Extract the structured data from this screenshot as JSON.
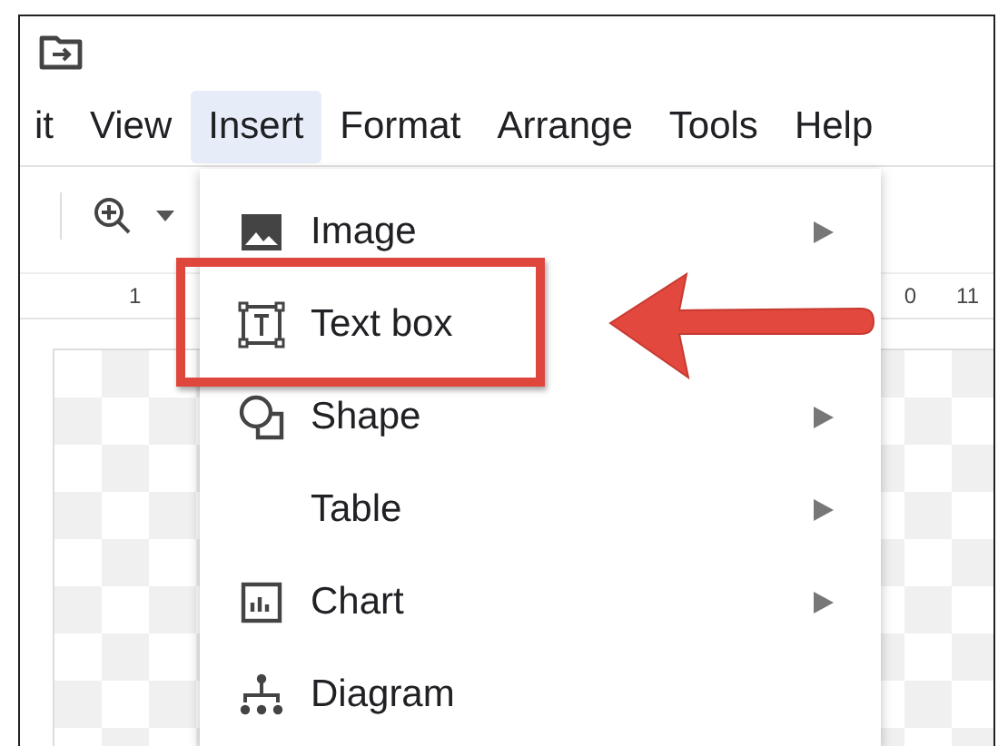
{
  "menu_bar": [
    {
      "label": "it",
      "selected": false
    },
    {
      "label": "View",
      "selected": false
    },
    {
      "label": "Insert",
      "selected": true
    },
    {
      "label": "Format",
      "selected": false
    },
    {
      "label": "Arrange",
      "selected": false
    },
    {
      "label": "Tools",
      "selected": false
    },
    {
      "label": "Help",
      "selected": false
    }
  ],
  "ruler": {
    "left_label": "1",
    "right_labels": [
      "0",
      "11"
    ]
  },
  "insert_menu": {
    "items": [
      {
        "label": "Image",
        "kind": "image",
        "submenu": true,
        "annotated": false
      },
      {
        "label": "Text box",
        "kind": "text-box",
        "submenu": false,
        "annotated": true
      },
      {
        "label": "Shape",
        "kind": "shape",
        "submenu": true,
        "annotated": false
      },
      {
        "label": "Table",
        "kind": "plain",
        "submenu": true,
        "annotated": false
      },
      {
        "label": "Chart",
        "kind": "chart",
        "submenu": true,
        "annotated": false
      },
      {
        "label": "Diagram",
        "kind": "diagram",
        "submenu": false,
        "annotated": false
      }
    ]
  }
}
